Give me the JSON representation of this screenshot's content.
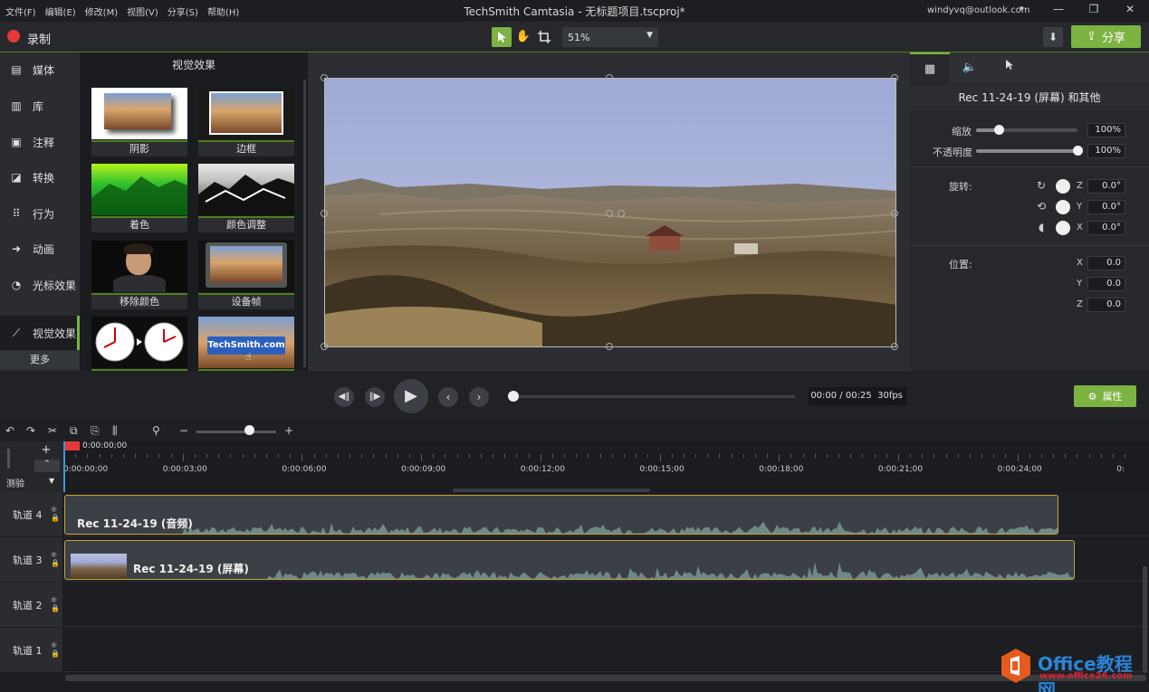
{
  "menu": [
    "文件(F)",
    "编辑(E)",
    "修改(M)",
    "视图(V)",
    "分享(S)",
    "帮助(H)"
  ],
  "window_title": "TechSmith Camtasia - 无标题项目.tscproj*",
  "account": "windyvq@outlook.com",
  "toolbar": {
    "record_label": "录制",
    "zoom_value": "51%",
    "share_label": "分享"
  },
  "left_tools": [
    "媒体",
    "库",
    "注释",
    "转换",
    "行为",
    "动画",
    "光标效果",
    "视觉效果"
  ],
  "more_label": "更多",
  "effects": {
    "title": "视觉效果",
    "items": [
      "阴影",
      "边框",
      "着色",
      "颜色调整",
      "移除颜色",
      "设备帧",
      "",
      ""
    ],
    "techsmith_badge": "TechSmith.com"
  },
  "properties": {
    "title": "Rec 11-24-19 (屏幕) 和其他",
    "scale_label": "缩放",
    "scale_value": "100%",
    "opacity_label": "不透明度",
    "opacity_value": "100%",
    "rotation_label": "旋转:",
    "rot_z": "0.0°",
    "rot_y": "0.0°",
    "rot_x": "0.0°",
    "position_label": "位置:",
    "pos_x": "0.0",
    "pos_y": "0.0",
    "pos_z": "0.0",
    "button_label": "属性",
    "scale_fraction": 0.22,
    "opacity_fraction": 1.0
  },
  "playback": {
    "timecode": "00:00 / 00:25",
    "fps": "30fps"
  },
  "ruler": {
    "playhead": "0:00:00;00",
    "labels": [
      "0:00:00;00",
      "0:00:03;00",
      "0:00:06;00",
      "0:00:09;00",
      "0:00:12;00",
      "0:00:15;00",
      "0:00:18;00",
      "0:00:21;00",
      "0:00:24;00",
      "0:"
    ]
  },
  "track_header_label": "测验",
  "tracks": [
    {
      "label": "轨道 4",
      "clip": "Rec 11-24-19 (音频)"
    },
    {
      "label": "轨道 3",
      "clip": "Rec 11-24-19 (屏幕)"
    },
    {
      "label": "轨道 2",
      "clip": ""
    },
    {
      "label": "轨道 1",
      "clip": ""
    }
  ],
  "watermark": {
    "title": "Office教程网",
    "url": "www.office26.com"
  },
  "colors": {
    "accent": "#7cb342",
    "record": "#e53935",
    "clip_border": "#c8a13a",
    "playhead": "#3a9ad9"
  }
}
